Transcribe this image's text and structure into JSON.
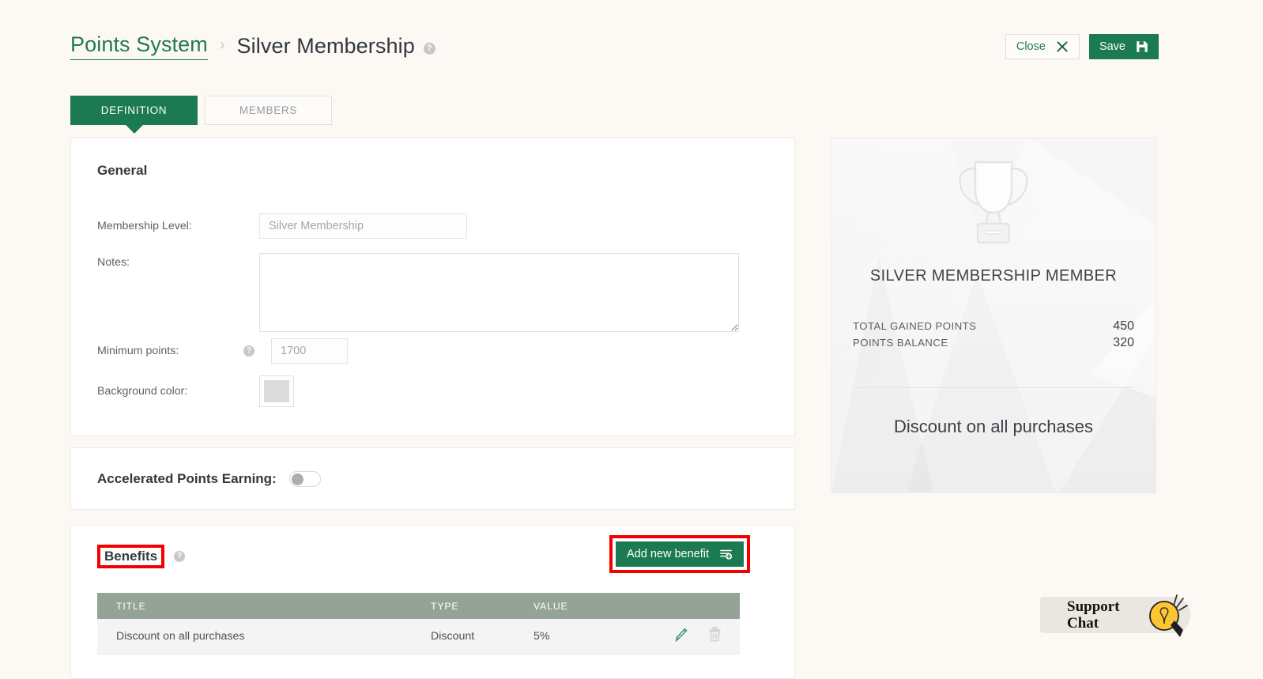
{
  "theme": {
    "page_bg": "#fcf8f4",
    "brand_green": "#1c7a53",
    "link_green": "#217a54",
    "table_header": "#95a396",
    "annotation_red": "#f40000",
    "bulb_yellow": "#fcc633"
  },
  "header": {
    "breadcrumb_parent": "Points System",
    "breadcrumb_separator": "›",
    "breadcrumb_current": "Silver Membership",
    "help_glyph": "?",
    "close_label": "Close",
    "close_icon": "close-x-icon",
    "save_label": "Save",
    "save_icon": "floppy-disk-icon"
  },
  "tabs": [
    {
      "label": "DEFINITION",
      "active": true
    },
    {
      "label": "MEMBERS",
      "active": false
    }
  ],
  "general": {
    "title": "General",
    "fields": {
      "membership_level": {
        "label": "Membership Level:",
        "value": "Silver Membership",
        "placeholder": "Silver Membership"
      },
      "notes": {
        "label": "Notes:",
        "value": "",
        "placeholder": ""
      },
      "minimum_points": {
        "label": "Minimum points:",
        "value": "1700",
        "placeholder": "1700",
        "has_help": true
      },
      "background_color": {
        "label": "Background color:",
        "swatch_color": "#dcdcdc"
      }
    }
  },
  "accelerated": {
    "label": "Accelerated Points Earning:",
    "toggle_state": "off"
  },
  "benefits": {
    "title": "Benefits",
    "title_annotated": true,
    "add_button_label": "Add new benefit",
    "add_button_icon": "add-list-item-icon",
    "add_button_annotated": true,
    "columns": [
      "TITLE",
      "TYPE",
      "VALUE",
      ""
    ],
    "rows": [
      {
        "title": "Discount on all purchases",
        "type": "Discount",
        "value": "5%",
        "edit_icon": "pencil-icon",
        "delete_icon": "trash-icon"
      }
    ]
  },
  "member_card": {
    "trophy_icon": "trophy-icon",
    "title": "SILVER MEMBERSHIP MEMBER",
    "stats": [
      {
        "key": "TOTAL GAINED POINTS",
        "value": "450"
      },
      {
        "key": "POINTS BALANCE",
        "value": "320"
      }
    ],
    "benefit_text": "Discount on all purchases"
  },
  "support_chat": {
    "label": "Support\nChat",
    "icon": "lightbulb-icon"
  }
}
